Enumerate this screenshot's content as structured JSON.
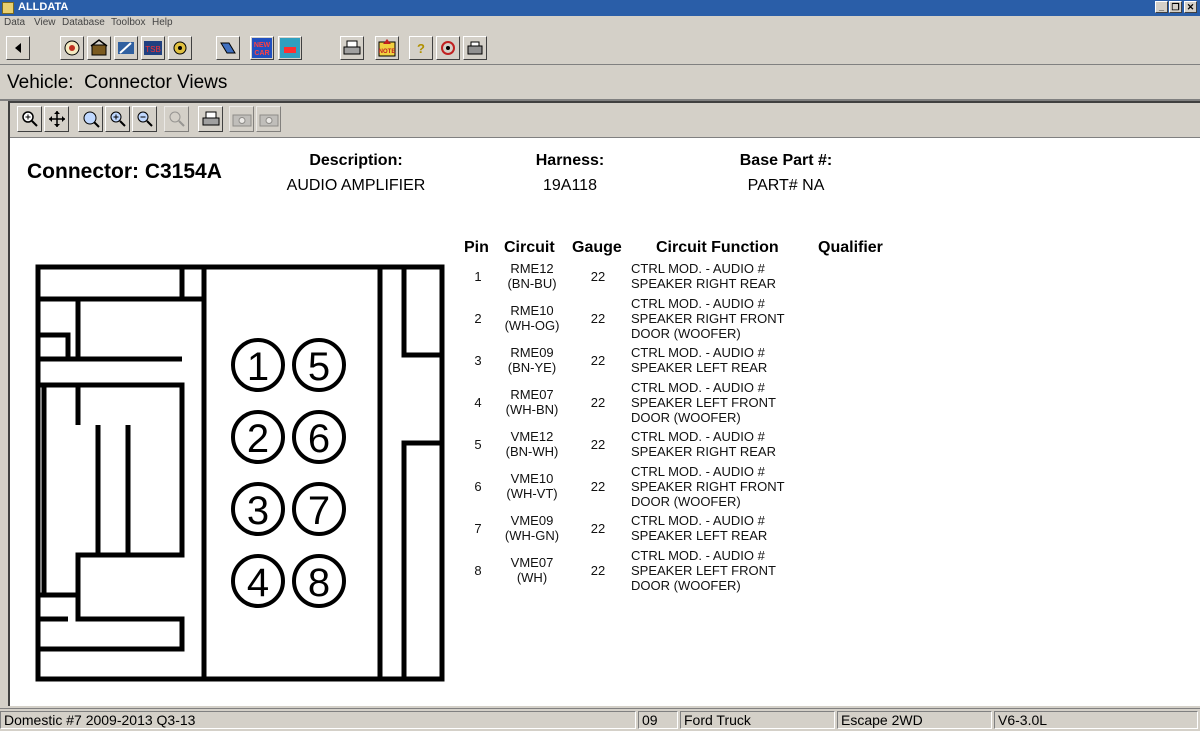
{
  "app": {
    "title": "ALLDATA"
  },
  "menu": {
    "items": [
      "Data",
      "View",
      "Database",
      "Toolbox",
      "Help"
    ]
  },
  "toolbar": {
    "icons": [
      "back-icon",
      "vehicle-select-icon",
      "home-icon",
      "repair-icon",
      "tsb-icon",
      "maintenance-icon",
      "component-icon",
      "new-car-icon",
      "new-car-alt-icon",
      "print-icon",
      "note-icon",
      "help-icon",
      "settings-icon",
      "printer-setup-icon"
    ],
    "new_car_label": "NEW CAR",
    "note_label": "NOTE",
    "tsb_label": "TSB"
  },
  "header": {
    "vehicle_label": "Vehicle:",
    "page_name": "Connector Views"
  },
  "zoom_toolbar": {
    "icons": [
      "zoom-in-icon",
      "pan-icon",
      "zoom-100-icon",
      "zoom-fit-icon",
      "zoom-out-icon",
      "zoom-reset-icon",
      "print-icon",
      "camera-icon",
      "camera-alt-icon"
    ]
  },
  "connector": {
    "title": "Connector: C3154A",
    "description_label": "Description:",
    "description": "AUDIO AMPLIFIER",
    "harness_label": "Harness:",
    "harness": "19A118",
    "base_part_label": "Base Part #:",
    "base_part": "PART# NA",
    "pin_numbers": [
      "1",
      "5",
      "2",
      "6",
      "3",
      "7",
      "4",
      "8"
    ]
  },
  "table": {
    "headers": {
      "pin": "Pin",
      "circuit": "Circuit",
      "gauge": "Gauge",
      "function": "Circuit Function",
      "qualifier": "Qualifier"
    },
    "rows": [
      {
        "pin": "1",
        "circuit": "RME12",
        "color": "(BN-BU)",
        "gauge": "22",
        "function": [
          "CTRL MOD. - AUDIO #",
          "SPEAKER RIGHT REAR"
        ]
      },
      {
        "pin": "2",
        "circuit": "RME10",
        "color": "(WH-OG)",
        "gauge": "22",
        "function": [
          "CTRL MOD. - AUDIO #",
          "SPEAKER RIGHT FRONT",
          "DOOR (WOOFER)"
        ]
      },
      {
        "pin": "3",
        "circuit": "RME09",
        "color": "(BN-YE)",
        "gauge": "22",
        "function": [
          "CTRL MOD. - AUDIO #",
          "SPEAKER LEFT REAR"
        ]
      },
      {
        "pin": "4",
        "circuit": "RME07",
        "color": "(WH-BN)",
        "gauge": "22",
        "function": [
          "CTRL MOD. - AUDIO #",
          "SPEAKER LEFT FRONT",
          "DOOR (WOOFER)"
        ]
      },
      {
        "pin": "5",
        "circuit": "VME12",
        "color": "(BN-WH)",
        "gauge": "22",
        "function": [
          "CTRL MOD. - AUDIO #",
          "SPEAKER RIGHT REAR"
        ]
      },
      {
        "pin": "6",
        "circuit": "VME10",
        "color": "(WH-VT)",
        "gauge": "22",
        "function": [
          "CTRL MOD. - AUDIO #",
          "SPEAKER RIGHT FRONT",
          "DOOR (WOOFER)"
        ]
      },
      {
        "pin": "7",
        "circuit": "VME09",
        "color": "(WH-GN)",
        "gauge": "22",
        "function": [
          "CTRL MOD. - AUDIO #",
          "SPEAKER LEFT REAR"
        ]
      },
      {
        "pin": "8",
        "circuit": "VME07",
        "color": "(WH)",
        "gauge": "22",
        "function": [
          "CTRL MOD. - AUDIO #",
          "SPEAKER LEFT FRONT",
          "DOOR (WOOFER)"
        ]
      }
    ]
  },
  "status": {
    "database": "Domestic #7 2009-2013 Q3-13",
    "year": "09",
    "make": "Ford Truck",
    "model": "Escape 2WD",
    "engine": "V6-3.0L"
  },
  "colors": {
    "titlebar": "#2a5ea8",
    "chrome": "#d4d0c8",
    "panel": "#ffffff"
  }
}
